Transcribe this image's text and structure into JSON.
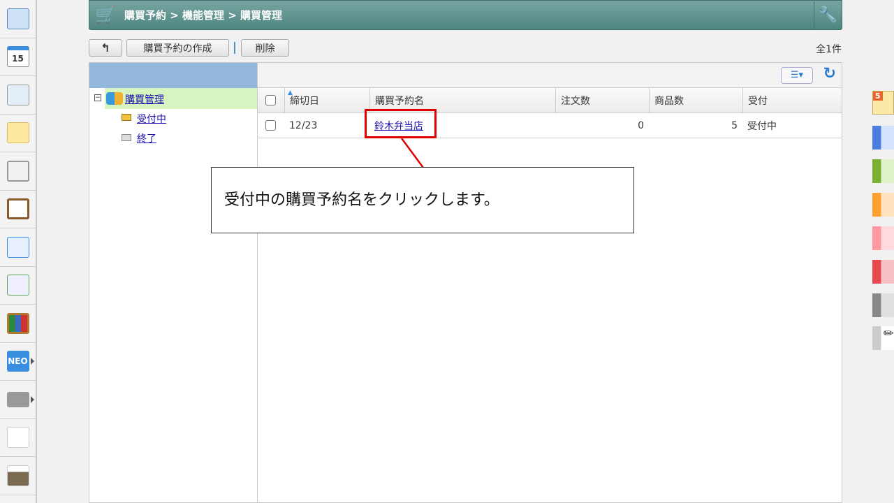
{
  "header": {
    "breadcrumb": "購買予約 > 機能管理 > 購買管理"
  },
  "toolbar": {
    "back_label": "↰",
    "create_label": "購買予約の作成",
    "delete_label": "削除",
    "total": "全1件"
  },
  "tree": {
    "root": "購買管理",
    "children": [
      "受付中",
      "終了"
    ]
  },
  "grid": {
    "columns": [
      "締切日",
      "購買予約名",
      "注文数",
      "商品数",
      "受付"
    ],
    "rows": [
      {
        "deadline": "12/23",
        "name": "鈴木弁当店",
        "orders": "0",
        "items": "5",
        "status": "受付中"
      }
    ]
  },
  "callout": {
    "text": "受付中の購買予約名をクリックします。"
  },
  "left_sidebar": {
    "icons": [
      "portal-icon",
      "calendar-icon",
      "facility-icon",
      "memo-icon",
      "bulletin-icon",
      "clipboard-icon",
      "survey-icon",
      "workflow-icon",
      "cabinet-icon",
      "neo-icon",
      "folder-icon",
      "banner-tanomail",
      "banner-photo"
    ],
    "calendar_day": "15",
    "neo_label": "NEO"
  },
  "right_sidebar": {
    "badge": "5",
    "colors": [
      "#4a7fe0",
      "#7ab030",
      "#ffa030",
      "#ff98a0",
      "#e84850",
      "#888888"
    ]
  },
  "colors": {
    "header": "#5a8f8a",
    "accent": "#e00000",
    "link": "#1a0dab"
  }
}
